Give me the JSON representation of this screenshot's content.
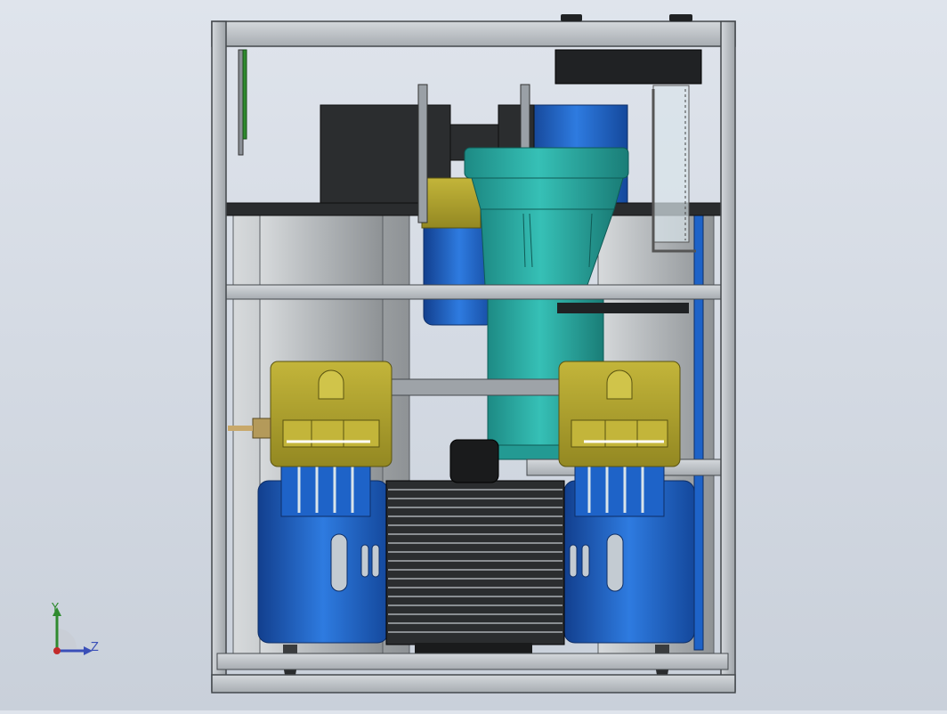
{
  "viewport": {
    "triad": {
      "y_label": "Y",
      "z_label": "Z"
    }
  },
  "colors": {
    "background_top": "#dfe4ec",
    "background_bottom": "#c9d0da",
    "frame": "#bcc2c8",
    "frame_edge": "#44484c",
    "tank": "#b5b9bc",
    "blue_part": "#1e63c8",
    "teal_filter": "#2aa8a0",
    "yellow_head": "#b0a330",
    "black_part": "#26282a",
    "axis_y": "#2f8a2f",
    "axis_z": "#3a4fb8",
    "axis_origin": "#c22a2a"
  },
  "icons": [
    "coordinate-triad-icon"
  ]
}
